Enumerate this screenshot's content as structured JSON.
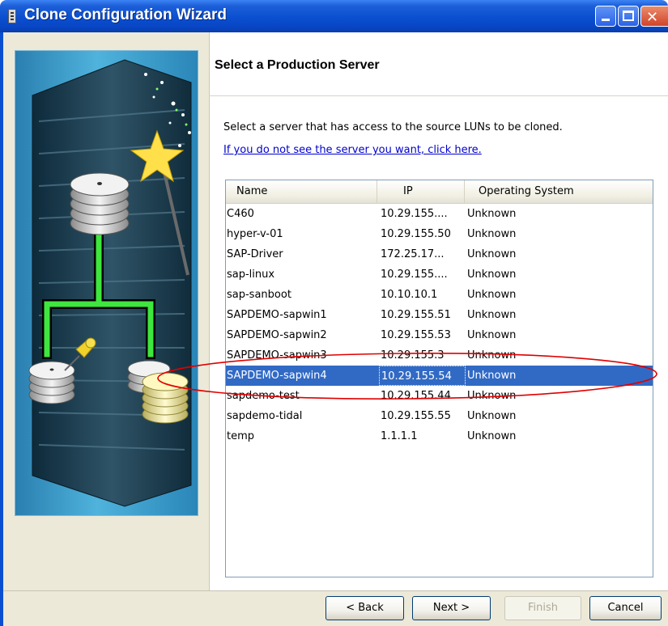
{
  "window": {
    "title": "Clone Configuration Wizard",
    "title_bar_color": "#0a4fd0"
  },
  "page": {
    "title": "Select a Production Server",
    "instruction": "Select a server that has access to the source LUNs to be cloned.",
    "help_link": "If you do not see the server you want, click here."
  },
  "table": {
    "columns": [
      "Name",
      "IP",
      "Operating System"
    ],
    "rows": [
      {
        "name": "C460",
        "ip": "10.29.155....",
        "os": "Unknown"
      },
      {
        "name": "hyper-v-01",
        "ip": "10.29.155.50",
        "os": "Unknown"
      },
      {
        "name": "SAP-Driver",
        "ip": "172.25.17...",
        "os": "Unknown"
      },
      {
        "name": "sap-linux",
        "ip": "10.29.155....",
        "os": "Unknown"
      },
      {
        "name": "sap-sanboot",
        "ip": "10.10.10.1",
        "os": "Unknown"
      },
      {
        "name": "SAPDEMO-sapwin1",
        "ip": "10.29.155.51",
        "os": "Unknown"
      },
      {
        "name": "SAPDEMO-sapwin2",
        "ip": "10.29.155.53",
        "os": "Unknown"
      },
      {
        "name": "SAPDEMO-sapwin3",
        "ip": "10.29.155.3",
        "os": "Unknown"
      },
      {
        "name": "SAPDEMO-sapwin4",
        "ip": "10.29.155.54",
        "os": "Unknown",
        "selected": true
      },
      {
        "name": "sapdemo-test",
        "ip": "10.29.155.44",
        "os": "Unknown"
      },
      {
        "name": "sapdemo-tidal",
        "ip": "10.29.155.55",
        "os": "Unknown"
      },
      {
        "name": "temp",
        "ip": "1.1.1.1",
        "os": "Unknown"
      }
    ],
    "selection_color": "#316ac5",
    "annotation_color": "#e00000"
  },
  "buttons": {
    "back": "< Back",
    "next": "Next >",
    "finish": "Finish",
    "cancel": "Cancel"
  },
  "icons": {
    "wizard_graphic": "server-rack-with-magic-wand-icon"
  }
}
